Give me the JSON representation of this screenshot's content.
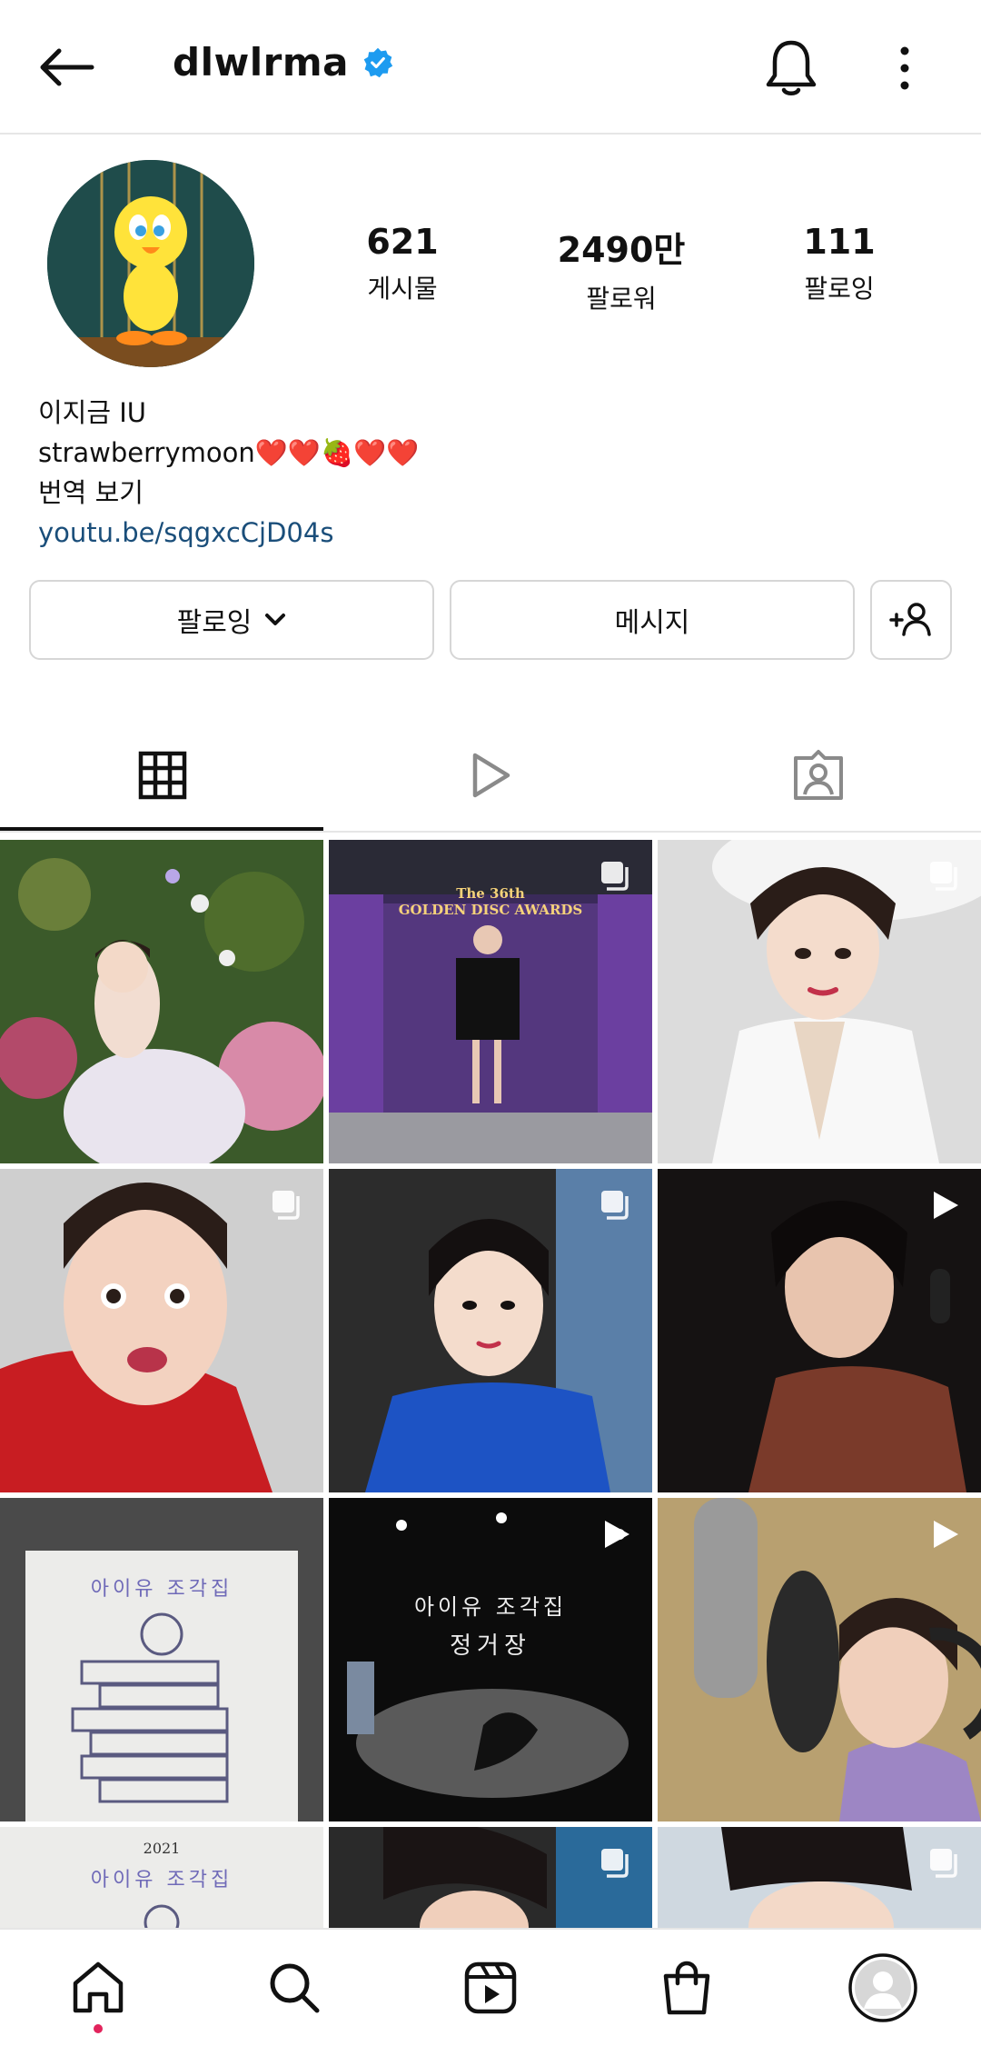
{
  "header": {
    "username": "dlwlrma",
    "back_icon": "arrow-left-icon",
    "bell_icon": "bell-icon",
    "more_icon": "vertical-dots-icon",
    "verified_color": "#1d9bf0"
  },
  "profile": {
    "stats": [
      {
        "num": "621",
        "label": "게시물"
      },
      {
        "num": "2490만",
        "label": "팔로워"
      },
      {
        "num": "111",
        "label": "팔로잉"
      }
    ],
    "bio": {
      "name": "이지금 IU",
      "line2": "strawberrymoon❤️❤️🍓❤️❤️",
      "translate": "번역 보기",
      "link": "youtu.be/sqgxcCjD04s"
    }
  },
  "actions": {
    "following_label": "팔로잉",
    "message_label": "메시지"
  },
  "grid": {
    "tiles": [
      {
        "name": "post-1",
        "badge": ""
      },
      {
        "name": "post-2",
        "badge": "carousel",
        "text": "The 36th\nGOLDEN DISC AWARDS"
      },
      {
        "name": "post-3",
        "badge": "carousel"
      },
      {
        "name": "post-4",
        "badge": "carousel"
      },
      {
        "name": "post-5",
        "badge": "carousel"
      },
      {
        "name": "post-6",
        "badge": "reel"
      },
      {
        "name": "post-7",
        "badge": "",
        "text": "아이유 조각집"
      },
      {
        "name": "post-8",
        "badge": "reel",
        "text": "아이유 조각집",
        "text2": "정거장"
      },
      {
        "name": "post-9",
        "badge": "reel"
      },
      {
        "name": "post-10",
        "badge": "",
        "text": "2021",
        "text2": "아이유 조각집"
      },
      {
        "name": "post-11",
        "badge": "carousel"
      },
      {
        "name": "post-12",
        "badge": "carousel"
      }
    ]
  },
  "colors": {
    "accent": "#e2245c",
    "link": "#1a4e7a"
  }
}
